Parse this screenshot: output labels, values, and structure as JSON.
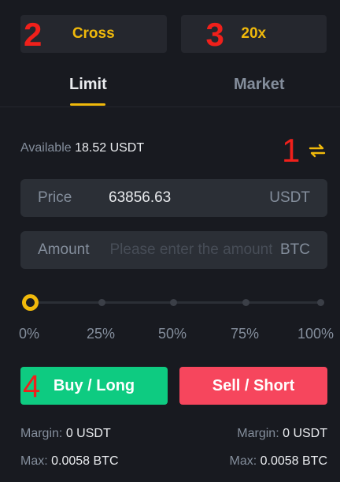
{
  "modes": {
    "margin_mode": "Cross",
    "leverage": "20x"
  },
  "annotations": {
    "a1": "1",
    "a2": "2",
    "a3": "3",
    "a4": "4"
  },
  "tabs": [
    {
      "label": "Limit",
      "active": true
    },
    {
      "label": "Market",
      "active": false
    }
  ],
  "available": {
    "label": "Available",
    "value": "18.52 USDT"
  },
  "price": {
    "label": "Price",
    "value": "63856.63",
    "unit": "USDT"
  },
  "amount": {
    "label": "Amount",
    "placeholder": "Please enter the amount",
    "unit": "BTC"
  },
  "slider": {
    "value_percent": 0,
    "marks": [
      "0%",
      "25%",
      "50%",
      "75%",
      "100%"
    ]
  },
  "buttons": {
    "buy": "Buy / Long",
    "sell": "Sell / Short"
  },
  "buy_info": {
    "margin_label": "Margin:",
    "margin_value": "0 USDT",
    "max_label": "Max:",
    "max_value": "0.0058 BTC"
  },
  "sell_info": {
    "margin_label": "Margin:",
    "margin_value": "0 USDT",
    "max_label": "Max:",
    "max_value": "0.0058 BTC"
  },
  "colors": {
    "accent": "#f0b90b",
    "buy": "#0ecb81",
    "sell": "#f6465d",
    "annotation": "#f0201b"
  }
}
